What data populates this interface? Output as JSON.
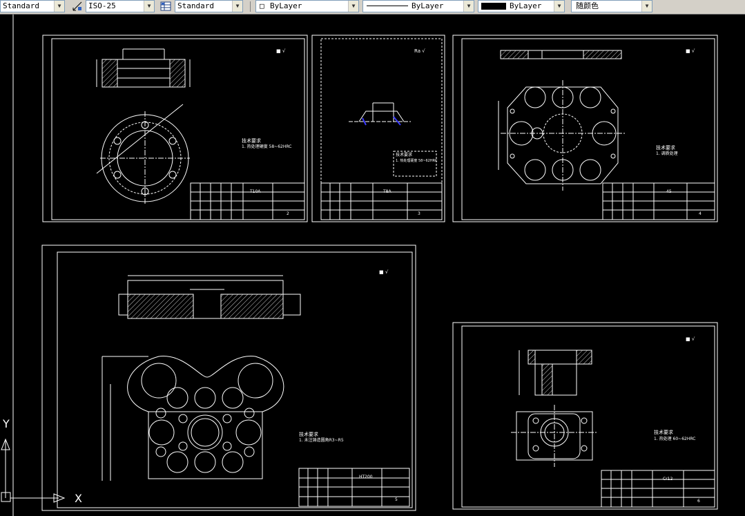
{
  "toolbar": {
    "text_style": "Standard",
    "dim_style": "ISO-25",
    "table_style": "Standard",
    "layer": "ByLayer",
    "linetype": "ByLayer",
    "lineweight": "ByLayer",
    "plot_style": "随颜色"
  },
  "ucs": {
    "x_label": "X",
    "y_label": "Y"
  },
  "sheets": [
    {
      "material": "T10A",
      "drawing_no": "",
      "sheet_no": "2",
      "tech_title": "技术要求",
      "tech_note": "1. 热处理硬度 58~62HRC"
    },
    {
      "material": "T8A",
      "drawing_no": "",
      "sheet_no": "3",
      "tech_title": "技术要求",
      "tech_note": "1. 热处理硬度 58~62HRC"
    },
    {
      "material": "45",
      "drawing_no": "",
      "sheet_no": "4",
      "tech_title": "技术要求",
      "tech_note": "1. 调质处理"
    },
    {
      "material": "HT200",
      "drawing_no": "",
      "sheet_no": "5",
      "tech_title": "技术要求",
      "tech_note": "1. 未注铸造圆角R3~R5"
    },
    {
      "material": "Cr12",
      "drawing_no": "",
      "sheet_no": "6",
      "tech_title": "技术要求",
      "tech_note": "1. 热处理 60~62HRC"
    }
  ],
  "colors": {
    "bg": "#000000",
    "line": "#ffffff",
    "accent": "#3b3bff",
    "toolbar": "#d4d0c8"
  }
}
